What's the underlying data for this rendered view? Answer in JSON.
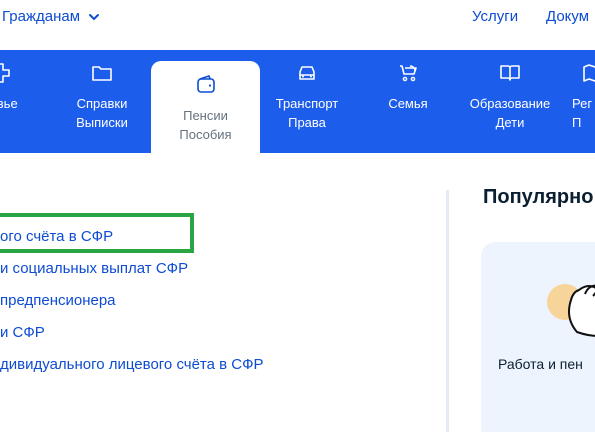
{
  "header": {
    "audience_label": "Гражданам",
    "links": [
      "Услуги",
      "Докум"
    ]
  },
  "nav": {
    "items": [
      {
        "label": "ровье",
        "icon": "health-cross-icon"
      },
      {
        "label": "Справки\nВыписки",
        "icon": "folder-icon"
      },
      {
        "label": "Пенсии\nПособия",
        "icon": "wallet-icon",
        "active": true
      },
      {
        "label": "Транспорт\nПрава",
        "icon": "car-icon"
      },
      {
        "label": "Семья",
        "icon": "stroller-icon"
      },
      {
        "label": "Образование\nДети",
        "icon": "book-icon"
      },
      {
        "label": "Рег\nП",
        "icon": "region-icon"
      }
    ]
  },
  "services": [
    "ого счёта в СФР",
    "и социальных выплат СФР",
    "предпенсионера",
    "и СФР",
    "дивидуального лицевого счёта в СФР"
  ],
  "popular": {
    "title": "Популярно",
    "card_title": "Работа и пен"
  },
  "colors": {
    "nav_bg": "#1d5deb",
    "link": "#0d4cd3",
    "highlight": "#2aa543",
    "card_bg": "#eef4fd"
  }
}
